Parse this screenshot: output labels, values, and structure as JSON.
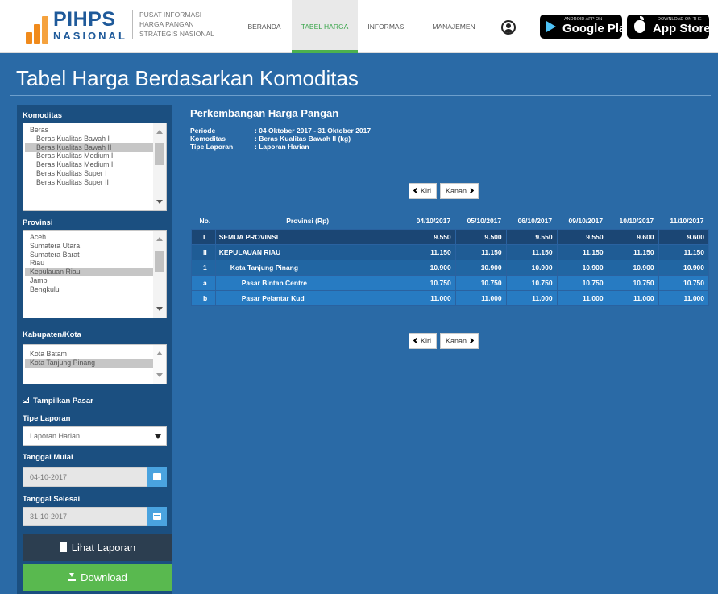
{
  "header": {
    "logo_word1": "PIHPS",
    "logo_word2": "NASIONAL",
    "tagline": [
      "PUSAT INFORMASI",
      "HARGA PANGAN",
      "STRATEGIS NASIONAL"
    ],
    "nav": [
      {
        "label": "BERANDA",
        "active": false
      },
      {
        "label": "TABEL HARGA",
        "active": true
      },
      {
        "label": "INFORMASI",
        "active": false
      },
      {
        "label": "MANAJEMEN",
        "active": false
      }
    ],
    "user_icon": "user-icon",
    "google_play": {
      "small": "ANDROID APP ON",
      "big": "Google Play",
      "icon": "play-store-icon"
    },
    "app_store": {
      "small": "Download on the",
      "big": "App Store",
      "icon": "apple-icon"
    }
  },
  "page_title": "Tabel Harga Berdasarkan Komoditas",
  "sidebar": {
    "komoditas": {
      "label": "Komoditas",
      "items": [
        {
          "text": "Beras",
          "sub": false,
          "selected": false
        },
        {
          "text": "Beras Kualitas Bawah I",
          "sub": true,
          "selected": false
        },
        {
          "text": "Beras Kualitas Bawah II",
          "sub": true,
          "selected": true
        },
        {
          "text": "Beras Kualitas Medium I",
          "sub": true,
          "selected": false
        },
        {
          "text": "Beras Kualitas Medium II",
          "sub": true,
          "selected": false
        },
        {
          "text": "Beras Kualitas Super I",
          "sub": true,
          "selected": false
        },
        {
          "text": "Beras Kualitas Super II",
          "sub": true,
          "selected": false
        }
      ]
    },
    "provinsi": {
      "label": "Provinsi",
      "items": [
        {
          "text": "Aceh",
          "selected": false
        },
        {
          "text": "Sumatera Utara",
          "selected": false
        },
        {
          "text": "Sumatera Barat",
          "selected": false
        },
        {
          "text": "Riau",
          "selected": false
        },
        {
          "text": "Kepulauan Riau",
          "selected": true
        },
        {
          "text": "Jambi",
          "selected": false
        },
        {
          "text": "Bengkulu",
          "selected": false
        }
      ]
    },
    "kabupaten": {
      "label": "Kabupaten/Kota",
      "items": [
        {
          "text": "Kota Batam",
          "selected": false
        },
        {
          "text": "Kota Tanjung Pinang",
          "selected": true
        }
      ]
    },
    "tampilkan_pasar": "Tampilkan Pasar",
    "tipe_laporan": {
      "label": "Tipe Laporan",
      "value": "Laporan Harian"
    },
    "tanggal_mulai": {
      "label": "Tanggal Mulai",
      "value": "04-10-2017"
    },
    "tanggal_selesai": {
      "label": "Tanggal Selesai",
      "value": "31-10-2017"
    },
    "lihat_label": "Lihat Laporan",
    "download_label": "Download"
  },
  "main": {
    "title": "Perkembangan Harga Pangan",
    "meta": [
      {
        "key": "Periode",
        "value": ": 04 Oktober 2017 - 31 Oktober 2017"
      },
      {
        "key": "Komoditas",
        "value": ": Beras Kualitas Bawah II (kg)"
      },
      {
        "key": "Tipe Laporan",
        "value": ": Laporan Harian"
      }
    ],
    "pager_prev": "Kiri",
    "pager_next": "Kanan",
    "table": {
      "headers": [
        "No.",
        "Provinsi (Rp)",
        "04/10/2017",
        "05/10/2017",
        "06/10/2017",
        "09/10/2017",
        "10/10/2017",
        "11/10/2017"
      ],
      "rows": [
        {
          "no": "I",
          "name": "SEMUA PROVINSI",
          "indent": 0,
          "values": [
            "9.550",
            "9.500",
            "9.550",
            "9.550",
            "9.600",
            "9.600"
          ]
        },
        {
          "no": "II",
          "name": "KEPULAUAN RIAU",
          "indent": 0,
          "values": [
            "11.150",
            "11.150",
            "11.150",
            "11.150",
            "11.150",
            "11.150"
          ]
        },
        {
          "no": "1",
          "name": "Kota Tanjung Pinang",
          "indent": 1,
          "values": [
            "10.900",
            "10.900",
            "10.900",
            "10.900",
            "10.900",
            "10.900"
          ]
        },
        {
          "no": "a",
          "name": "Pasar Bintan Centre",
          "indent": 2,
          "values": [
            "10.750",
            "10.750",
            "10.750",
            "10.750",
            "10.750",
            "10.750"
          ]
        },
        {
          "no": "b",
          "name": "Pasar Pelantar Kud",
          "indent": 2,
          "values": [
            "11.000",
            "11.000",
            "11.000",
            "11.000",
            "11.000",
            "11.000"
          ]
        }
      ]
    }
  }
}
